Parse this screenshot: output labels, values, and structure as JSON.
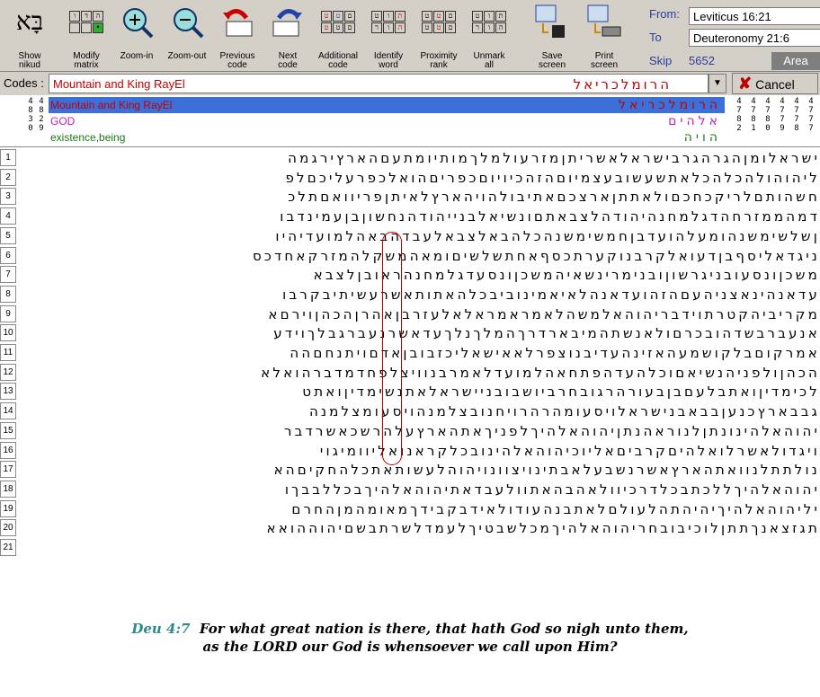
{
  "toolbar": {
    "buttons": [
      {
        "label": "Show\nnikud"
      },
      {
        "label": "Modify\nmatrix"
      },
      {
        "label": "Zoom-in"
      },
      {
        "label": "Zoom-out"
      },
      {
        "label": "Previous\ncode"
      },
      {
        "label": "Next\ncode"
      },
      {
        "label": "Additional\ncode"
      },
      {
        "label": "Identify\nword"
      },
      {
        "label": "Proximity\nrank"
      },
      {
        "label": "Unmark\nall"
      },
      {
        "label": "Save\nscreen"
      },
      {
        "label": "Print\nscreen"
      }
    ],
    "logo": "בָּא"
  },
  "range": {
    "from_label": "From:",
    "to_label": "To",
    "skip_label": "Skip",
    "from_value": "Leviticus 16:21",
    "to_value": "Deuteronomy 21:6",
    "skip_value": "5652",
    "area_label": "Area"
  },
  "codes": {
    "label": "Codes :",
    "value": "Mountain and King RayEl",
    "hebrew": "הרומלכריאל",
    "cancel_label": "Cancel"
  },
  "legend": {
    "col_nums": [
      "4\n8\n3\n0",
      "4\n8\n2\n9"
    ],
    "right_nums": [
      "4\n7\n8\n2",
      "4\n7\n8\n1",
      "4\n7\n8\n0",
      "4\n7\n7\n9",
      "4\n7\n7\n8",
      "4\n7\n7\n7"
    ],
    "rows": [
      {
        "label": "Mountain and King RayEl",
        "hebrew": "הרומלכריאל"
      },
      {
        "label": "GOD",
        "hebrew": "אלהים"
      },
      {
        "label": "existence,being",
        "hebrew": "הויה"
      }
    ]
  },
  "matrix": {
    "rows": [
      "ישראלומןהגרהגרבישראלאשריתןמזרעולמלךמותיומתעםהארץירגמה",
      "ליהוהולהכלהכלאתשעשובעצמיוםהזהכיויוםכפריםהואלכפרעליכםלפ",
      "חשהותםלריקכחכםולאתתןארצכםאתיבולהויהארץלאיתןפריוואםתלכ",
      "דמהממזרחהדגלמחנהיהודהלצבאתםונשיאלבנייהודהנחשוןבןעמינדבו",
      "ןשלשימשנהומעלהועדבןחמשימשנהכלהבאלצבאלעבדהבאהלמועדיהיו",
      "ניגדאליסףבןדעואלקרבנוקערתכסףאחתשלשיםומאהמשקלהמזרקאחדכס",
      "משכןונסעובניגרשוןובנימרינשאיהמשכןונסעדגלמחנהראובןלצבא",
      "עדאנהינאצניהעםהזהועדאנהלאיאמינוביבכלהאתותאשרעשיתיבקרבו",
      "מקריביהקטרתוידבריהוהאלמשהלאמראמראלאלעזרבןאהרןהכהןוירםא",
      "אנעברבשדהובכרםולאנשתהמיבארדרךהמלךנלךעדאשרנעברגבלךוידע",
      "אמרקוםבלקושמעהאזינהעדיבנוצפרלאאישאליכזבובןאדםויתנחםהה",
      "הכהןולפניהנשיאםוכלהעדהפתחאהלמועדלאמרבנוויצלפחדמדברהואלא",
      "לכימדיןואתבלעםבןבעורהרגובחרביושבובניישראלאתנשימדיןואתט",
      "גבבארץכנעןבבאבנישראלויסעומהרהרויחנובצלמנהויסעומצלמנה",
      "יהוהאלהינונתןלנוראהנתןיהוהאלהיךלפניךאתהארץעלהרשכאשרדבר",
      "ויגדולאשרלואלהיםקרביםאליוכיהוהאלהינובכלקראנואליוומיגוי",
      "נולתתלנוואתהארץאשרנשבעלאבתינויצוונויהוהלעשותאתכלהחקיםהא",
      "יהוהאלהיךללכתבכלדרכיוולאהבהאתוולעבדאתיהוהאלהיךבכללבבךו",
      "יליהוהאלהיךיהיהתהלעולםלאתבנהעודולאידבקבידךמאומהמןהחרם",
      "תגזצאנךתתןלוכיבובחריהוהאלהיךמכלשבטיךלעמדלשרתבשםיהוההואא"
    ],
    "row_numbers": [
      "1",
      "2",
      "3",
      "4",
      "5",
      "6",
      "7",
      "8",
      "9",
      "10",
      "11",
      "12",
      "13",
      "14",
      "15",
      "16",
      "17",
      "18",
      "19",
      "20",
      "21"
    ]
  },
  "verse": {
    "ref": "Deu 4:7",
    "line1": "For what great nation is there, that hath God so nigh unto them,",
    "line2": "as the LORD our God is whensoever we call upon Him?"
  },
  "colors": {
    "accent": "#c00000",
    "select": "#3c6fd8",
    "chrome": "#d4d0c8"
  }
}
